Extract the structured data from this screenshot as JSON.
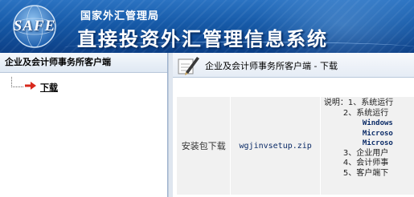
{
  "header": {
    "logo_text": "SAFE",
    "agency_name": "国家外汇管理局",
    "system_title": "直接投资外汇管理信息系统"
  },
  "sidebar": {
    "title": "企业及会计师事务所客户端",
    "items": [
      {
        "label": "下载",
        "icon": "red-arrow-icon"
      }
    ]
  },
  "main": {
    "title": "企业及会计师事务所客户端 - 下载",
    "table": {
      "label": "安装包下载",
      "file_name": "wgjinvsetup.zip",
      "notes": [
        "说明：1、系统运行",
        "2、系统运行",
        "Windows",
        "Microso",
        "Microso",
        "3、企业用户",
        "4、会计师事",
        "5、客户端下"
      ]
    }
  },
  "colors": {
    "header_blue": "#165aa8",
    "arrow_red": "#d8281c"
  }
}
